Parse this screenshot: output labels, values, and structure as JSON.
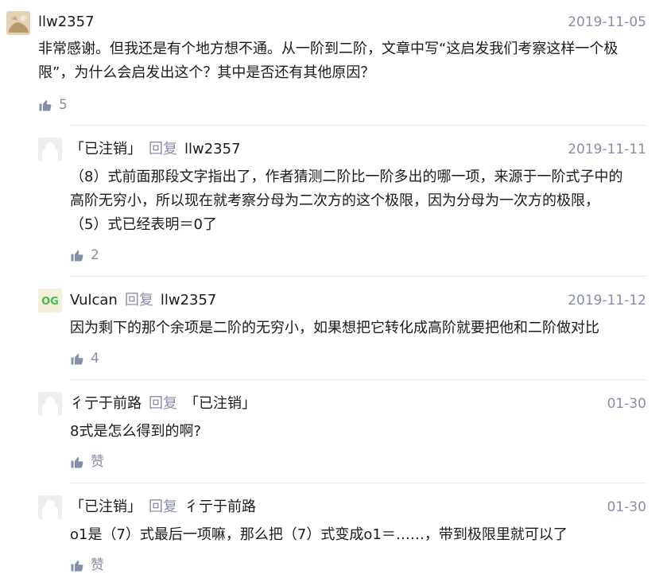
{
  "comments": [
    {
      "author": "llw2357",
      "reply_to": "",
      "reply_word": "",
      "time": "2019-11-05",
      "text_lines": [
        "非常感谢。但我还是有个地方想不通。从一阶到二阶，文章中写“这启发我们考察这样一个极",
        "限”，为什么会启发出这个？其中是否还有其他原因？"
      ],
      "likes": "5",
      "avatar_icon": "photo-avatar"
    },
    {
      "author": "「已注销」",
      "reply_word": "回复",
      "reply_to": "llw2357",
      "time": "2019-11-11",
      "text_lines": [
        "（8）式前面那段文字指出了，作者猜测二阶比一阶多出的哪一项，来源于一阶式子中的",
        "高阶无穷小，所以现在就考察分母为二次方的这个极限，因为分母为一次方的极限，",
        "（5）式已经表明＝0了"
      ],
      "likes": "2",
      "avatar_icon": "default-avatar"
    },
    {
      "author": "Vulcan",
      "reply_word": "回复",
      "reply_to": "llw2357",
      "time": "2019-11-12",
      "text_lines": [
        "因为剩下的那个余项是二阶的无穷小，如果想把它转化成高阶就要把他和二阶做对比"
      ],
      "likes": "4",
      "avatar_icon": "og-logo-avatar",
      "avatar_text": "OG"
    },
    {
      "author": "彳亍于前路",
      "reply_word": "回复",
      "reply_to": "「已注销」",
      "time": "01-30",
      "text_lines": [
        "8式是怎么得到的啊?"
      ],
      "likes": "赞",
      "avatar_icon": "default-avatar"
    },
    {
      "author": "「已注销」",
      "reply_word": "回复",
      "reply_to": "彳亍于前路",
      "time": "01-30",
      "text_lines": [
        "o1是（7）式最后一项嘛，那么把（7）式变成o1＝……，带到极限里就可以了"
      ],
      "likes": "赞",
      "avatar_icon": "default-avatar"
    }
  ],
  "colors": {
    "text": "#1a1a1a",
    "meta": "#8590a6",
    "divider": "#ececec",
    "og_green": "#3fb950"
  }
}
